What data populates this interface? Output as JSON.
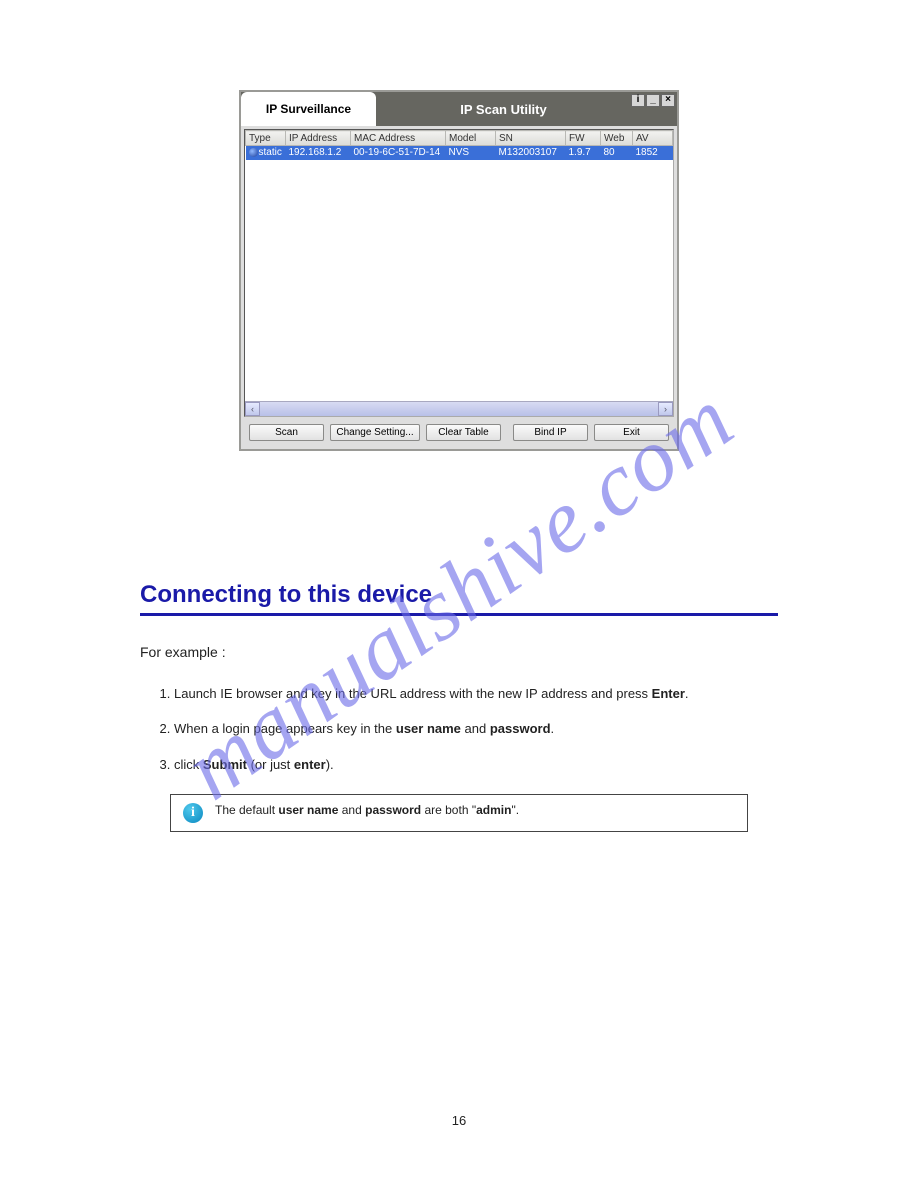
{
  "window": {
    "tab_label": "IP Surveillance",
    "title": "IP Scan Utility",
    "buttons": {
      "info": "i",
      "min": "_",
      "close": "×"
    }
  },
  "table": {
    "headers": [
      "Type",
      "IP Address",
      "MAC Address",
      "Model",
      "SN",
      "FW",
      "Web",
      "AV"
    ],
    "row": {
      "type": "static",
      "ip": "192.168.1.2",
      "mac": "00-19-6C-51-7D-14",
      "model": "NVS",
      "sn": "M132003107",
      "fw": "1.9.7",
      "web": "80",
      "av": "1852"
    }
  },
  "scroll": {
    "left": "‹",
    "right": "›"
  },
  "buttons": {
    "scan": "Scan",
    "change": "Change Setting...",
    "clear": "Clear Table",
    "bind": "Bind IP",
    "exit": "Exit"
  },
  "section": {
    "heading": "Connecting to this device",
    "for_example": "For example :",
    "step1_a": "Launch IE browser and key in the URL address with the new IP address and press ",
    "step1_b": "Enter",
    "step1_c": ".",
    "step2_a": "When a login page appears key in the ",
    "step2_b": "user name",
    "step2_c": " and ",
    "step2_d": "password",
    "step2_e": ".",
    "step3_a": "click ",
    "step3_b": "Submit",
    "step3_c": " (or just ",
    "step3_d": "enter",
    "step3_e": ")."
  },
  "note": {
    "text_a": "The default ",
    "text_b": "user name",
    "text_c": " and ",
    "text_d": "password",
    "text_e": " are both \"",
    "text_f": "admin",
    "text_g": "\"."
  },
  "watermark": "manualshive.com",
  "page_number": "16"
}
